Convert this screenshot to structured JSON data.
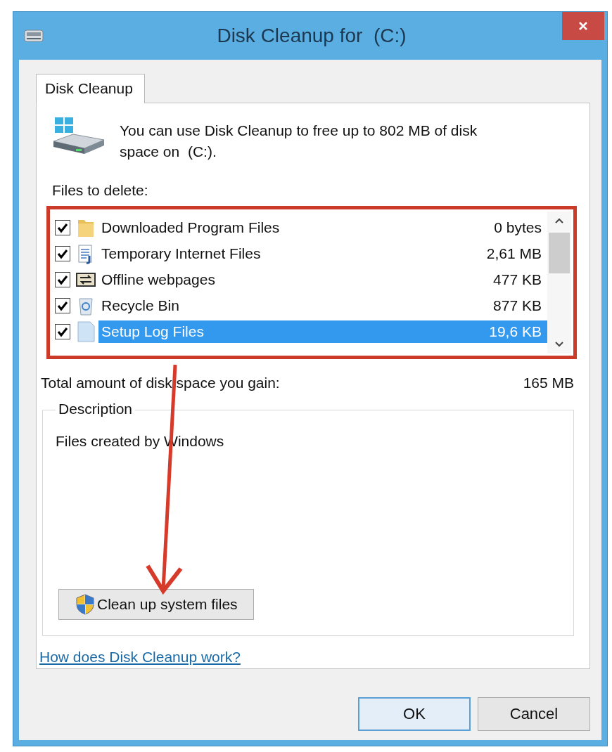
{
  "window": {
    "title": "Disk Cleanup for  (C:)"
  },
  "tabs": [
    {
      "label": "Disk Cleanup",
      "selected": true
    }
  ],
  "intro": "You can use Disk Cleanup to free up to 802 MB of disk space on  (C:).",
  "files_label": "Files to delete:",
  "files": [
    {
      "name": "Downloaded Program Files",
      "size": "0 bytes",
      "checked": true,
      "selected": false
    },
    {
      "name": "Temporary Internet Files",
      "size": "2,61 MB",
      "checked": true,
      "selected": false
    },
    {
      "name": "Offline webpages",
      "size": "477 KB",
      "checked": true,
      "selected": false
    },
    {
      "name": "Recycle Bin",
      "size": "877 KB",
      "checked": true,
      "selected": false
    },
    {
      "name": "Setup Log Files",
      "size": "19,6 KB",
      "checked": true,
      "selected": true
    }
  ],
  "total": {
    "label": "Total amount of disk space you gain:",
    "value": "165 MB"
  },
  "description": {
    "legend": "Description",
    "text": "Files created by Windows"
  },
  "system_button": "Clean up system files",
  "help_link": "How does Disk Cleanup work?",
  "buttons": [
    "OK",
    "Cancel"
  ]
}
